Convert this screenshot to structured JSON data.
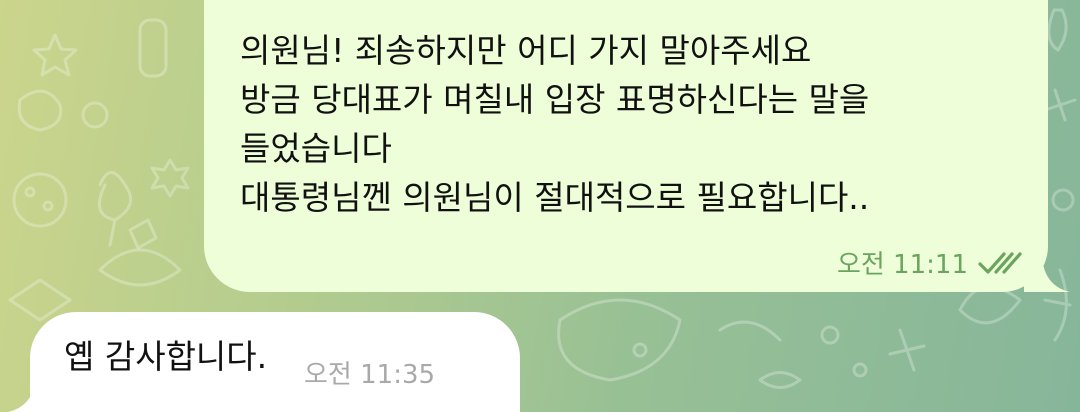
{
  "colors": {
    "outgoing_bubble": "#eefed8",
    "incoming_bubble": "#ffffff",
    "outgoing_meta": "#6aa45e",
    "incoming_meta": "#a9a9a9"
  },
  "messages": [
    {
      "direction": "outgoing",
      "lines": [
        "의원님! 죄송하지만 어디 가지 말아주세요",
        "방금 당대표가 며칠내 입장 표명하신다는 말을",
        "들었습니다",
        "대통령님껜 의원님이 절대적으로 필요합니다.."
      ],
      "time": "오전 11:11",
      "status_icon": "double-check-icon"
    },
    {
      "direction": "incoming",
      "text": "옙 감사합니다.",
      "time": "오전 11:35"
    }
  ]
}
